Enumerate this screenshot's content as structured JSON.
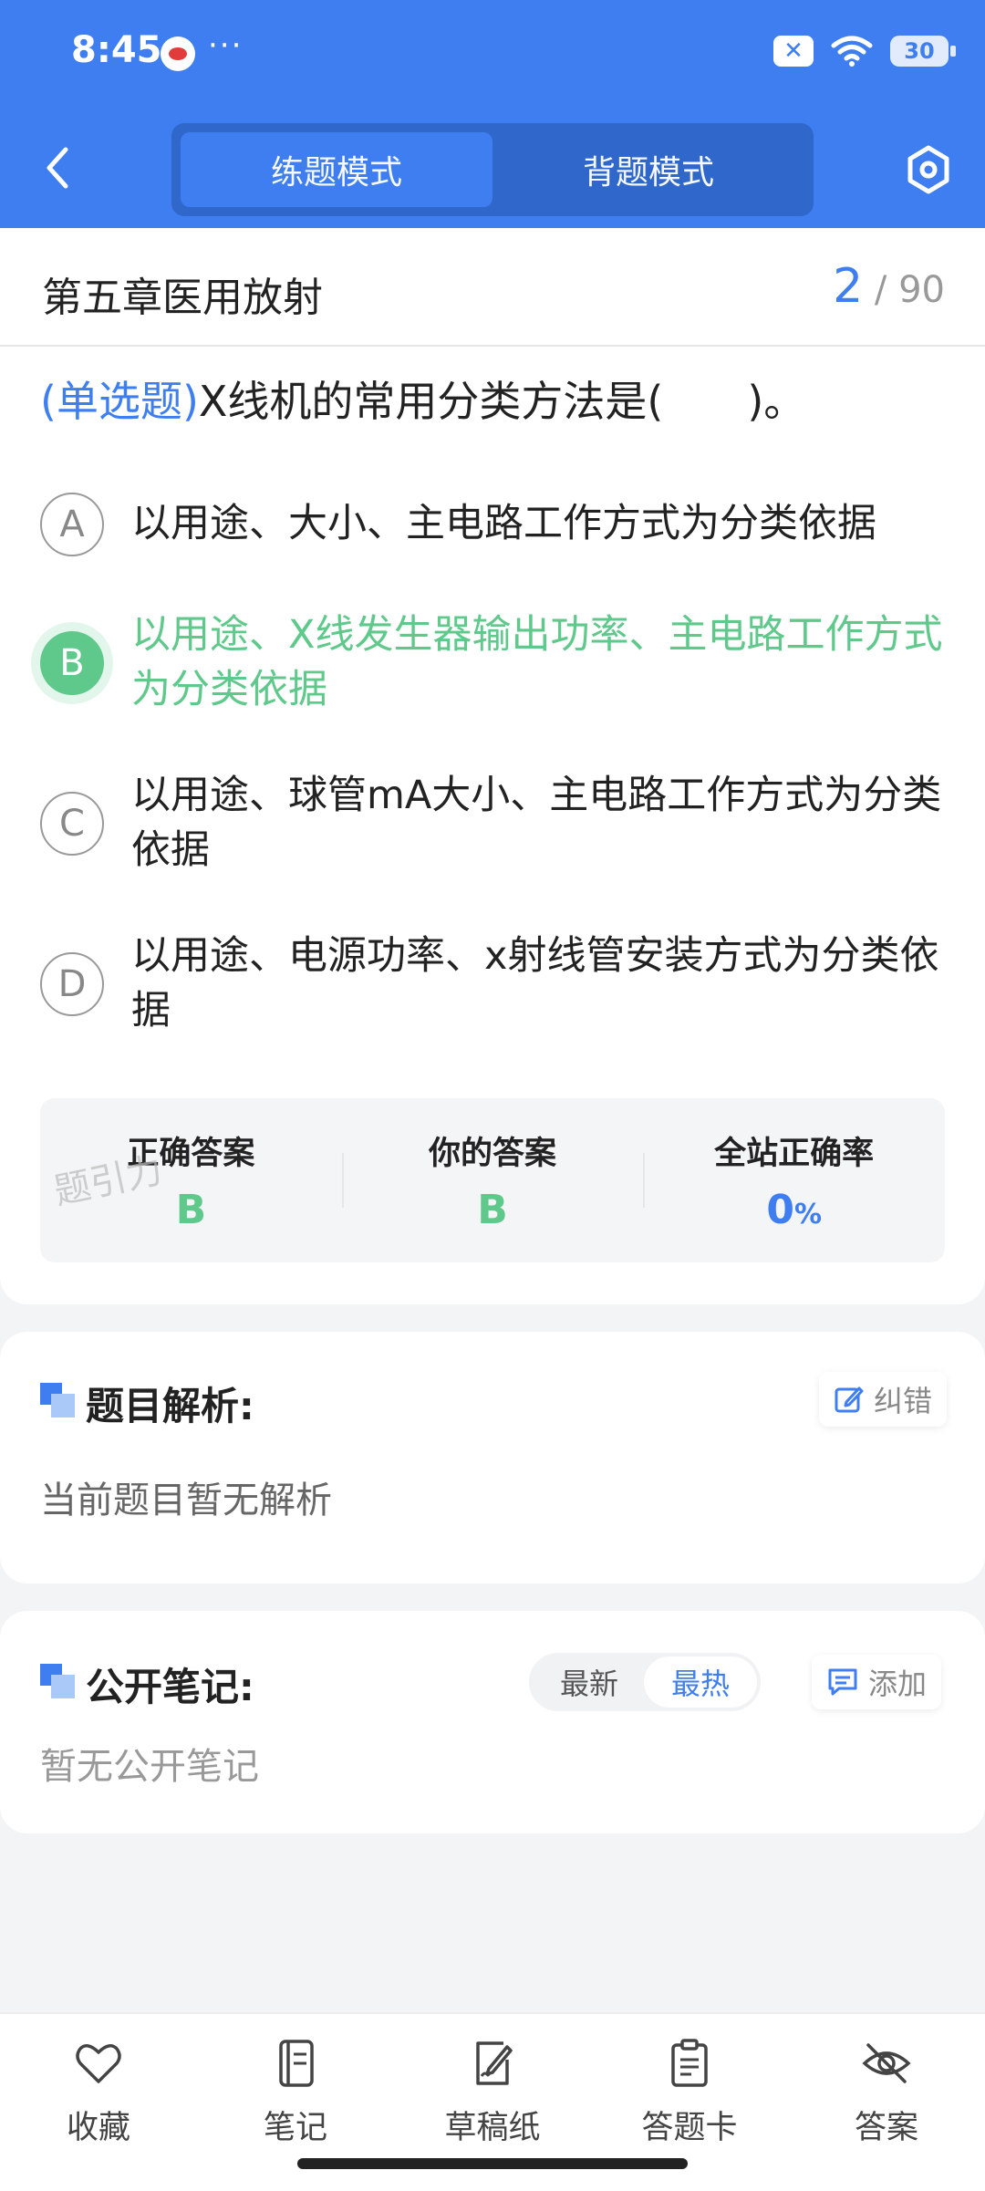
{
  "status_bar": {
    "time": "8:45",
    "dots": "···",
    "battery": "30"
  },
  "header": {
    "mode_practice": "练题模式",
    "mode_memorize": "背题模式"
  },
  "question": {
    "chapter": "第五章医用放射",
    "current": "2",
    "total_text": "/ 90",
    "type": "(单选题)",
    "text": "X线机的常用分类方法是(　　)。",
    "options": [
      {
        "letter": "A",
        "text": "以用途、大小、主电路工作方式为分类依据"
      },
      {
        "letter": "B",
        "text": "以用途、X线发生器输出功率、主电路工作方式为分类依据"
      },
      {
        "letter": "C",
        "text": "以用途、球管mA大小、主电路工作方式为分类依据"
      },
      {
        "letter": "D",
        "text": "以用途、电源功率、x射线管安装方式为分类依据"
      }
    ],
    "selected": "B"
  },
  "answers": {
    "correct_label": "正确答案",
    "correct_value": "B",
    "yours_label": "你的答案",
    "yours_value": "B",
    "rate_label": "全站正确率",
    "rate_value": "0",
    "rate_unit": "%",
    "watermark": "题引力"
  },
  "analysis": {
    "title": "题目解析:",
    "report_label": "纠错",
    "body": "当前题目暂无解析"
  },
  "notes": {
    "title": "公开笔记:",
    "sort_latest": "最新",
    "sort_hot": "最热",
    "add_label": "添加",
    "body": "暂无公开笔记"
  },
  "bottom_nav": [
    {
      "label": "收藏",
      "icon": "heart-icon"
    },
    {
      "label": "笔记",
      "icon": "notebook-icon"
    },
    {
      "label": "草稿纸",
      "icon": "draft-icon"
    },
    {
      "label": "答题卡",
      "icon": "answer-sheet-icon"
    },
    {
      "label": "答案",
      "icon": "eye-off-icon"
    }
  ],
  "colors": {
    "primary": "#3f7ef0",
    "correct": "#5ec98a"
  }
}
